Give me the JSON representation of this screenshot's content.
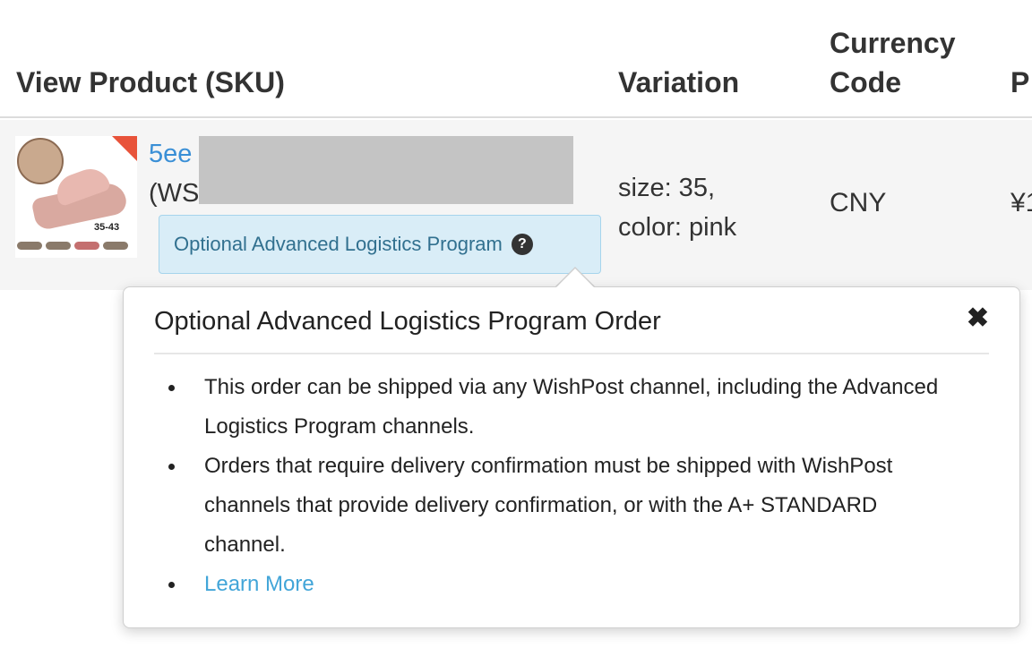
{
  "table": {
    "headers": {
      "product": "View Product (SKU)",
      "variation": "Variation",
      "currency": "Currency Code",
      "price_partial": "P"
    },
    "row": {
      "product_id_visible": "5ee",
      "sku_visible": "(WS",
      "badge_label": "Optional Advanced Logistics Program",
      "help_icon": "?",
      "variation_line1": "size: 35,",
      "variation_line2": "color: pink",
      "currency": "CNY",
      "price_partial": "¥1",
      "thumbnail_size_label": "35-43"
    }
  },
  "popover": {
    "title": "Optional Advanced Logistics Program Order",
    "close_icon": "✖",
    "items": [
      "This order can be shipped via any WishPost channel, including the Advanced Logistics Program channels.",
      "Orders that require delivery confirmation must be shipped with WishPost channels that provide delivery confirmation, or with the A+ STANDARD channel."
    ],
    "learn_more": "Learn More"
  },
  "colors": {
    "link": "#3a8fd6",
    "badge_bg": "#d9edf7",
    "badge_text": "#31708f",
    "learn_more": "#42a5d8",
    "row_bg": "#f5f5f5"
  }
}
